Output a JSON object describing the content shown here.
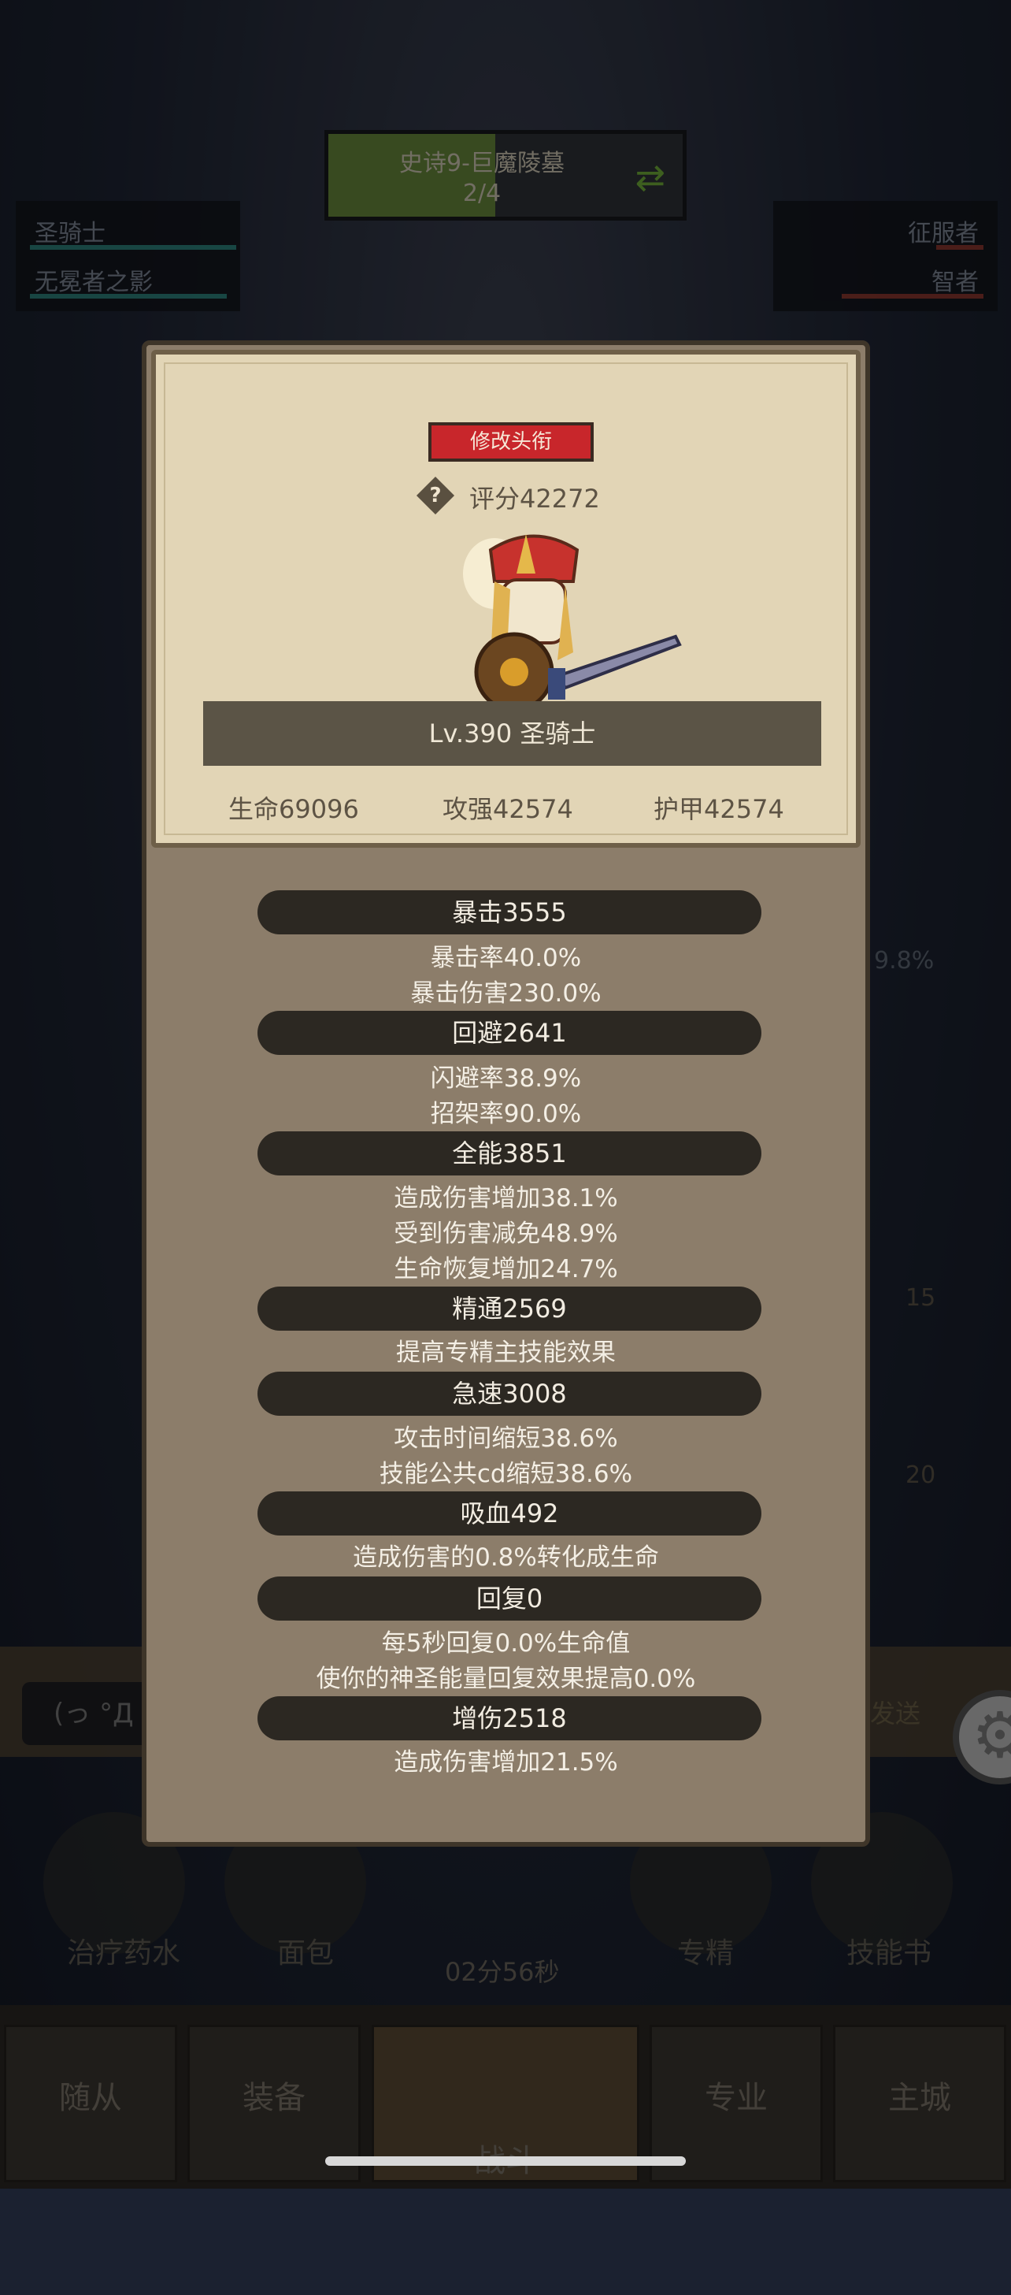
{
  "quest": {
    "title": "史诗9-巨魔陵墓",
    "progress": "2/4",
    "progress_value": 0.47
  },
  "left_panel": {
    "items": [
      "圣骑士",
      "无冕者之影"
    ]
  },
  "right_panel": {
    "items": [
      "征服者",
      "智者"
    ]
  },
  "background": {
    "items": [
      "治疗药水",
      "面包",
      "专精",
      "技能书"
    ],
    "timer": "02分56秒",
    "chat_text": "(っ °Д °",
    "nav": [
      "随从",
      "装备",
      "战斗",
      "专业",
      "主城"
    ],
    "side_text": "9.8%",
    "badges": [
      "15",
      "20"
    ],
    "send": "发送"
  },
  "modal": {
    "title_button": "修改头衔",
    "score": "评分42272",
    "level_name": "Lv.390 圣骑士",
    "main_stats": [
      "生命69096",
      "攻强42574",
      "护甲42574"
    ],
    "sections": [
      {
        "label": "暴击3555",
        "lines": [
          "暴击率40.0%",
          "暴击伤害230.0%"
        ]
      },
      {
        "label": "回避2641",
        "lines": [
          "闪避率38.9%",
          "招架率90.0%"
        ]
      },
      {
        "label": "全能3851",
        "lines": [
          "造成伤害增加38.1%",
          "受到伤害减免48.9%",
          "生命恢复增加24.7%"
        ]
      },
      {
        "label": "精通2569",
        "lines": [
          "提高专精主技能效果"
        ]
      },
      {
        "label": "急速3008",
        "lines": [
          "攻击时间缩短38.6%",
          "技能公共cd缩短38.6%"
        ]
      },
      {
        "label": "吸血492",
        "lines": [
          "造成伤害的0.8%转化成生命"
        ]
      },
      {
        "label": "回复0",
        "lines": [
          "每5秒回复0.0%生命值",
          "使你的神圣能量回复效果提高0.0%"
        ]
      },
      {
        "label": "增伤2518",
        "lines": [
          "造成伤害增加21.5%"
        ]
      }
    ]
  },
  "colors": {
    "title_button": "#c8262b",
    "quest_fill": "#7aa53c",
    "modal_bg": "#8c7d6a",
    "card_bg": "#e2d5b6"
  }
}
